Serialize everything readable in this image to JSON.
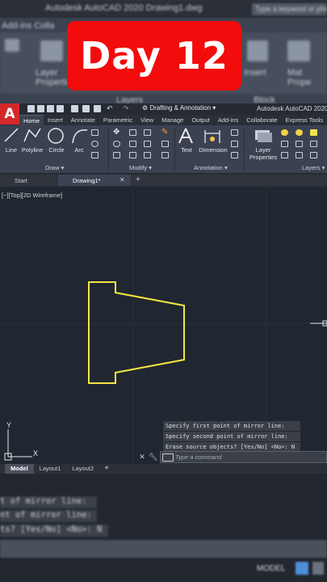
{
  "banner": {
    "text": "Day 12"
  },
  "background": {
    "title": "Autodesk AutoCAD 2020  Drawing1.dwg",
    "search": "Type a keyword or phrase",
    "tabs_partial": "Add-ins    Colla",
    "ribbon_left": "Layer Properties",
    "ribbon_right_1": "Insert",
    "ribbon_right_2": "Mat Prope",
    "layers_partial": "Layers",
    "block_partial": "Block"
  },
  "titlebar": {
    "workspace": "Drafting & Annotation",
    "app_title": "Autodesk AutoCAD 2020",
    "logo": "A"
  },
  "ribbon_tabs": [
    "Home",
    "Insert",
    "Annotate",
    "Parametric",
    "View",
    "Manage",
    "Output",
    "Add-ins",
    "Collaborate",
    "Express Tools"
  ],
  "tools": {
    "line": "Line",
    "polyline": "Polyline",
    "circle": "Circle",
    "arc": "Arc",
    "text": "Text",
    "dimension": "Dimension",
    "layer_properties_1": "Layer",
    "layer_properties_2": "Properties"
  },
  "panels": {
    "draw": "Draw ▾",
    "modify": "Modify ▾",
    "annotation": "Annotation ▾",
    "layers": "Layers ▾"
  },
  "file_tabs": {
    "start": "Start",
    "drawing": "Drawing1*"
  },
  "viewport": {
    "label": "[−][Top][2D Wireframe]"
  },
  "command_history": [
    "Specify first point of mirror line:",
    "Specify second point of mirror line:",
    "Erase source objects? [Yes/No] <No>: N"
  ],
  "command_line": {
    "placeholder": "Type a command"
  },
  "layout_tabs": [
    "Model",
    "Layout1",
    "Layout2"
  ],
  "bottom_history": [
    "t of mirror line:",
    "nt of mirror line:",
    "ts? [Yes/No] <No>: N"
  ],
  "status": {
    "model": "MODEL"
  },
  "colors": {
    "shape_stroke": "#f5e642",
    "banner": "#f20c0c",
    "viewport": "#212730"
  }
}
